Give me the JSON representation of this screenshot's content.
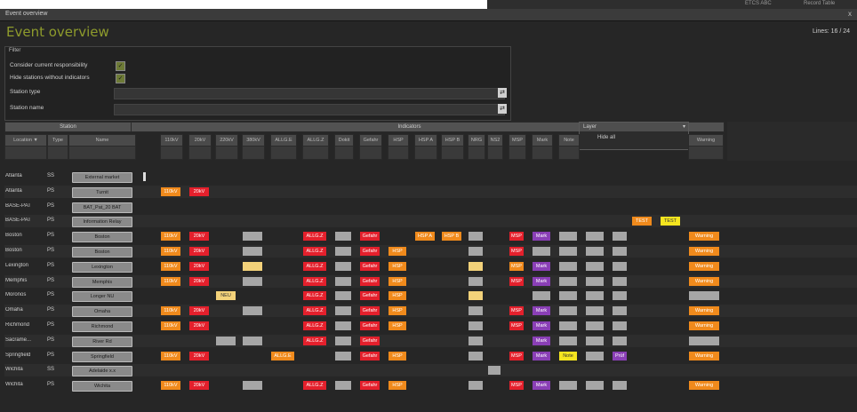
{
  "colors": {
    "orange": "#f08a1c",
    "red": "#e4202c",
    "gray": "#a6a6a6",
    "lightyellow": "#f3d27a",
    "purple": "#8a3fb6",
    "yellow": "#f5e51f",
    "heading": "#8e9b2c"
  },
  "background_window": {
    "left_text": "ETCS ABC",
    "right_text": "Record Table"
  },
  "window": {
    "title": "Event overview",
    "close": "x",
    "heading": "Event overview",
    "lines": "Lines: 16 / 24"
  },
  "filter": {
    "title": "Filter",
    "opt1": "Consider current responsibility",
    "opt2": "Hide stations without indicators",
    "checkmark": "✓",
    "field1": "Station type",
    "field2": "Station name",
    "drop": "⇄"
  },
  "header": {
    "station_group": "Station",
    "indicators_group": "Indicators",
    "warning_group": "",
    "layer_title": "Layer",
    "layer_arrow": "▾",
    "layer_value": "Hide all",
    "columns": [
      {
        "key": "location",
        "label": "Location ▼"
      },
      {
        "key": "type",
        "label": "Type"
      },
      {
        "key": "name",
        "label": "Name"
      },
      {
        "key": "c1",
        "label": "110kV"
      },
      {
        "key": "c2",
        "label": "20kV"
      },
      {
        "key": "c3",
        "label": "220kV"
      },
      {
        "key": "c4",
        "label": "380kV"
      },
      {
        "key": "c5",
        "label": "ALLG.E"
      },
      {
        "key": "c6",
        "label": "ALLG.Z"
      },
      {
        "key": "c7",
        "label": "Dokit"
      },
      {
        "key": "c8",
        "label": "Gefahr"
      },
      {
        "key": "c9",
        "label": "HSP"
      },
      {
        "key": "c10",
        "label": "HSP A"
      },
      {
        "key": "c11",
        "label": "HSP B"
      },
      {
        "key": "c12",
        "label": "NRG"
      },
      {
        "key": "c13",
        "label": "NS2"
      },
      {
        "key": "c14",
        "label": "MSP"
      },
      {
        "key": "c15",
        "label": "Mark"
      },
      {
        "key": "c16",
        "label": "Note"
      },
      {
        "key": "warn",
        "label": "Warning"
      }
    ]
  },
  "rows": [
    {
      "location": "Atlanta",
      "type": "SS",
      "name": "External market",
      "cells": []
    },
    {
      "location": "Atlanta",
      "type": "PS",
      "name": "Turnit",
      "cells": [
        {
          "c": 0,
          "t": "110kV",
          "k": "orange"
        },
        {
          "c": 1,
          "t": "20kV",
          "k": "red"
        }
      ]
    },
    {
      "location": "BASE-PAT",
      "type": "PS",
      "name": "BAT_Pat_20 BAT",
      "cells": []
    },
    {
      "location": "BASE-PAT",
      "type": "PS",
      "name": "Information Relay",
      "cells": [
        {
          "c": 18,
          "t": "TEST",
          "k": "orange"
        },
        {
          "c": 19,
          "t": "TEST",
          "k": "yellow"
        }
      ]
    },
    {
      "location": "Boston",
      "type": "PS",
      "name": "Boston",
      "cells": [
        {
          "c": 0,
          "t": "110kV",
          "k": "orange"
        },
        {
          "c": 1,
          "t": "20kV",
          "k": "red"
        },
        {
          "c": 3,
          "t": "",
          "k": "gray"
        },
        {
          "c": 5,
          "t": "ALLG.Z",
          "k": "red"
        },
        {
          "c": 6,
          "t": "",
          "k": "gray"
        },
        {
          "c": 7,
          "t": "Gefahr",
          "k": "red"
        },
        {
          "c": 9,
          "t": "HSP A",
          "k": "orange"
        },
        {
          "c": 10,
          "t": "HSP B",
          "k": "orange"
        },
        {
          "c": 11,
          "t": "",
          "k": "gray"
        },
        {
          "c": 13,
          "t": "MSP",
          "k": "red"
        },
        {
          "c": 14,
          "t": "Mark",
          "k": "purple"
        },
        {
          "c": 15,
          "t": "",
          "k": "gray"
        },
        {
          "c": 16,
          "t": "",
          "k": "gray"
        },
        {
          "c": 17,
          "t": "",
          "k": "gray"
        },
        {
          "c": 20,
          "t": "Warning",
          "k": "orange"
        }
      ]
    },
    {
      "location": "Boston",
      "type": "PS",
      "name": "Boston",
      "cells": [
        {
          "c": 0,
          "t": "110kV",
          "k": "orange"
        },
        {
          "c": 1,
          "t": "20kV",
          "k": "red"
        },
        {
          "c": 3,
          "t": "",
          "k": "gray"
        },
        {
          "c": 5,
          "t": "ALLG.Z",
          "k": "red"
        },
        {
          "c": 6,
          "t": "",
          "k": "gray"
        },
        {
          "c": 7,
          "t": "Gefahr",
          "k": "red"
        },
        {
          "c": 8,
          "t": "HSP",
          "k": "orange"
        },
        {
          "c": 11,
          "t": "",
          "k": "gray"
        },
        {
          "c": 13,
          "t": "MSP",
          "k": "red"
        },
        {
          "c": 14,
          "t": "",
          "k": "gray"
        },
        {
          "c": 15,
          "t": "",
          "k": "gray"
        },
        {
          "c": 16,
          "t": "",
          "k": "gray"
        },
        {
          "c": 17,
          "t": "",
          "k": "gray"
        },
        {
          "c": 20,
          "t": "Warning",
          "k": "orange"
        }
      ]
    },
    {
      "location": "Lexington",
      "type": "PS",
      "name": "Lexington",
      "cells": [
        {
          "c": 0,
          "t": "110kV",
          "k": "orange"
        },
        {
          "c": 1,
          "t": "20kV",
          "k": "red"
        },
        {
          "c": 3,
          "t": "",
          "k": "lightyellow"
        },
        {
          "c": 5,
          "t": "ALLG.Z",
          "k": "red"
        },
        {
          "c": 6,
          "t": "",
          "k": "gray"
        },
        {
          "c": 7,
          "t": "Gefahr",
          "k": "red"
        },
        {
          "c": 8,
          "t": "HSP",
          "k": "orange"
        },
        {
          "c": 11,
          "t": "",
          "k": "lightyellow"
        },
        {
          "c": 13,
          "t": "MSP",
          "k": "orange"
        },
        {
          "c": 14,
          "t": "Mark",
          "k": "purple"
        },
        {
          "c": 15,
          "t": "",
          "k": "gray"
        },
        {
          "c": 16,
          "t": "",
          "k": "gray"
        },
        {
          "c": 17,
          "t": "",
          "k": "gray"
        },
        {
          "c": 20,
          "t": "Warning",
          "k": "orange"
        }
      ]
    },
    {
      "location": "Memphis",
      "type": "PS",
      "name": "Memphis",
      "cells": [
        {
          "c": 0,
          "t": "110kV",
          "k": "orange"
        },
        {
          "c": 1,
          "t": "20kV",
          "k": "red"
        },
        {
          "c": 3,
          "t": "",
          "k": "gray"
        },
        {
          "c": 5,
          "t": "ALLG.Z",
          "k": "red"
        },
        {
          "c": 6,
          "t": "",
          "k": "gray"
        },
        {
          "c": 7,
          "t": "Gefahr",
          "k": "red"
        },
        {
          "c": 8,
          "t": "HSP",
          "k": "orange"
        },
        {
          "c": 11,
          "t": "",
          "k": "gray"
        },
        {
          "c": 13,
          "t": "MSP",
          "k": "red"
        },
        {
          "c": 14,
          "t": "Mark",
          "k": "purple"
        },
        {
          "c": 15,
          "t": "",
          "k": "gray"
        },
        {
          "c": 16,
          "t": "",
          "k": "gray"
        },
        {
          "c": 17,
          "t": "",
          "k": "gray"
        },
        {
          "c": 20,
          "t": "Warning",
          "k": "orange"
        }
      ]
    },
    {
      "location": "Moronos",
      "type": "PS",
      "name": "Longer NU",
      "cells": [
        {
          "c": 2,
          "t": "NEU",
          "k": "lightyellow"
        },
        {
          "c": 5,
          "t": "ALLG.Z",
          "k": "red"
        },
        {
          "c": 6,
          "t": "",
          "k": "gray"
        },
        {
          "c": 7,
          "t": "Gefahr",
          "k": "red"
        },
        {
          "c": 8,
          "t": "HSP",
          "k": "orange"
        },
        {
          "c": 11,
          "t": "",
          "k": "lightyellow"
        },
        {
          "c": 14,
          "t": "",
          "k": "gray"
        },
        {
          "c": 15,
          "t": "",
          "k": "gray"
        },
        {
          "c": 16,
          "t": "",
          "k": "gray"
        },
        {
          "c": 17,
          "t": "",
          "k": "gray"
        },
        {
          "c": 20,
          "t": "",
          "k": "gray"
        }
      ]
    },
    {
      "location": "Omaha",
      "type": "PS",
      "name": "Omaha",
      "cells": [
        {
          "c": 0,
          "t": "110kV",
          "k": "orange"
        },
        {
          "c": 1,
          "t": "20kV",
          "k": "red"
        },
        {
          "c": 3,
          "t": "",
          "k": "gray"
        },
        {
          "c": 5,
          "t": "ALLG.Z",
          "k": "red"
        },
        {
          "c": 6,
          "t": "",
          "k": "gray"
        },
        {
          "c": 7,
          "t": "Gefahr",
          "k": "red"
        },
        {
          "c": 8,
          "t": "HSP",
          "k": "orange"
        },
        {
          "c": 11,
          "t": "",
          "k": "gray"
        },
        {
          "c": 13,
          "t": "MSP",
          "k": "red"
        },
        {
          "c": 14,
          "t": "Mark",
          "k": "purple"
        },
        {
          "c": 15,
          "t": "",
          "k": "gray"
        },
        {
          "c": 16,
          "t": "",
          "k": "gray"
        },
        {
          "c": 17,
          "t": "",
          "k": "gray"
        },
        {
          "c": 20,
          "t": "Warning",
          "k": "orange"
        }
      ]
    },
    {
      "location": "Richmond",
      "type": "PS",
      "name": "Richmond",
      "cells": [
        {
          "c": 0,
          "t": "110kV",
          "k": "orange"
        },
        {
          "c": 1,
          "t": "20kV",
          "k": "red"
        },
        {
          "c": 5,
          "t": "ALLG.Z",
          "k": "red"
        },
        {
          "c": 6,
          "t": "",
          "k": "gray"
        },
        {
          "c": 7,
          "t": "Gefahr",
          "k": "red"
        },
        {
          "c": 8,
          "t": "HSP",
          "k": "orange"
        },
        {
          "c": 11,
          "t": "",
          "k": "gray"
        },
        {
          "c": 13,
          "t": "MSP",
          "k": "red"
        },
        {
          "c": 14,
          "t": "Mark",
          "k": "purple"
        },
        {
          "c": 15,
          "t": "",
          "k": "gray"
        },
        {
          "c": 16,
          "t": "",
          "k": "gray"
        },
        {
          "c": 17,
          "t": "",
          "k": "gray"
        },
        {
          "c": 20,
          "t": "Warning",
          "k": "orange"
        }
      ]
    },
    {
      "location": "Sacrame...",
      "type": "PS",
      "name": "River Rd",
      "cells": [
        {
          "c": 2,
          "t": "",
          "k": "gray"
        },
        {
          "c": 3,
          "t": "",
          "k": "gray"
        },
        {
          "c": 5,
          "t": "ALLG.Z",
          "k": "red"
        },
        {
          "c": 6,
          "t": "",
          "k": "gray"
        },
        {
          "c": 7,
          "t": "Gefahr",
          "k": "red"
        },
        {
          "c": 11,
          "t": "",
          "k": "gray"
        },
        {
          "c": 14,
          "t": "Mark",
          "k": "purple"
        },
        {
          "c": 15,
          "t": "",
          "k": "gray"
        },
        {
          "c": 16,
          "t": "",
          "k": "gray"
        },
        {
          "c": 17,
          "t": "",
          "k": "gray"
        },
        {
          "c": 20,
          "t": "",
          "k": "gray"
        }
      ]
    },
    {
      "location": "Springfield",
      "type": "PS",
      "name": "Springfield",
      "cells": [
        {
          "c": 0,
          "t": "110kV",
          "k": "orange"
        },
        {
          "c": 1,
          "t": "20kV",
          "k": "red"
        },
        {
          "c": 4,
          "t": "ALLG.E",
          "k": "orange"
        },
        {
          "c": 6,
          "t": "",
          "k": "gray"
        },
        {
          "c": 7,
          "t": "Gefahr",
          "k": "red"
        },
        {
          "c": 8,
          "t": "HSP",
          "k": "orange"
        },
        {
          "c": 11,
          "t": "",
          "k": "gray"
        },
        {
          "c": 13,
          "t": "MSP",
          "k": "red"
        },
        {
          "c": 14,
          "t": "Mark",
          "k": "purple"
        },
        {
          "c": 15,
          "t": "Note",
          "k": "yellow"
        },
        {
          "c": 16,
          "t": "",
          "k": "gray"
        },
        {
          "c": 17,
          "t": "Prüf",
          "k": "purple"
        },
        {
          "c": 20,
          "t": "Warning",
          "k": "orange"
        }
      ]
    },
    {
      "location": "Wichita",
      "type": "SS",
      "name": "Adelaide x.x",
      "cells": [
        {
          "c": 12,
          "t": "",
          "k": "gray"
        }
      ]
    },
    {
      "location": "Wichita",
      "type": "PS",
      "name": "Wichita",
      "cells": [
        {
          "c": 0,
          "t": "110kV",
          "k": "orange"
        },
        {
          "c": 1,
          "t": "20kV",
          "k": "red"
        },
        {
          "c": 3,
          "t": "",
          "k": "gray"
        },
        {
          "c": 5,
          "t": "ALLG.Z",
          "k": "red"
        },
        {
          "c": 6,
          "t": "",
          "k": "gray"
        },
        {
          "c": 7,
          "t": "Gefahr",
          "k": "red"
        },
        {
          "c": 8,
          "t": "HSP",
          "k": "orange"
        },
        {
          "c": 11,
          "t": "",
          "k": "gray"
        },
        {
          "c": 13,
          "t": "MSP",
          "k": "red"
        },
        {
          "c": 14,
          "t": "Mark",
          "k": "purple"
        },
        {
          "c": 15,
          "t": "",
          "k": "gray"
        },
        {
          "c": 16,
          "t": "",
          "k": "gray"
        },
        {
          "c": 17,
          "t": "",
          "k": "gray"
        },
        {
          "c": 20,
          "t": "Warning",
          "k": "orange"
        }
      ]
    }
  ]
}
